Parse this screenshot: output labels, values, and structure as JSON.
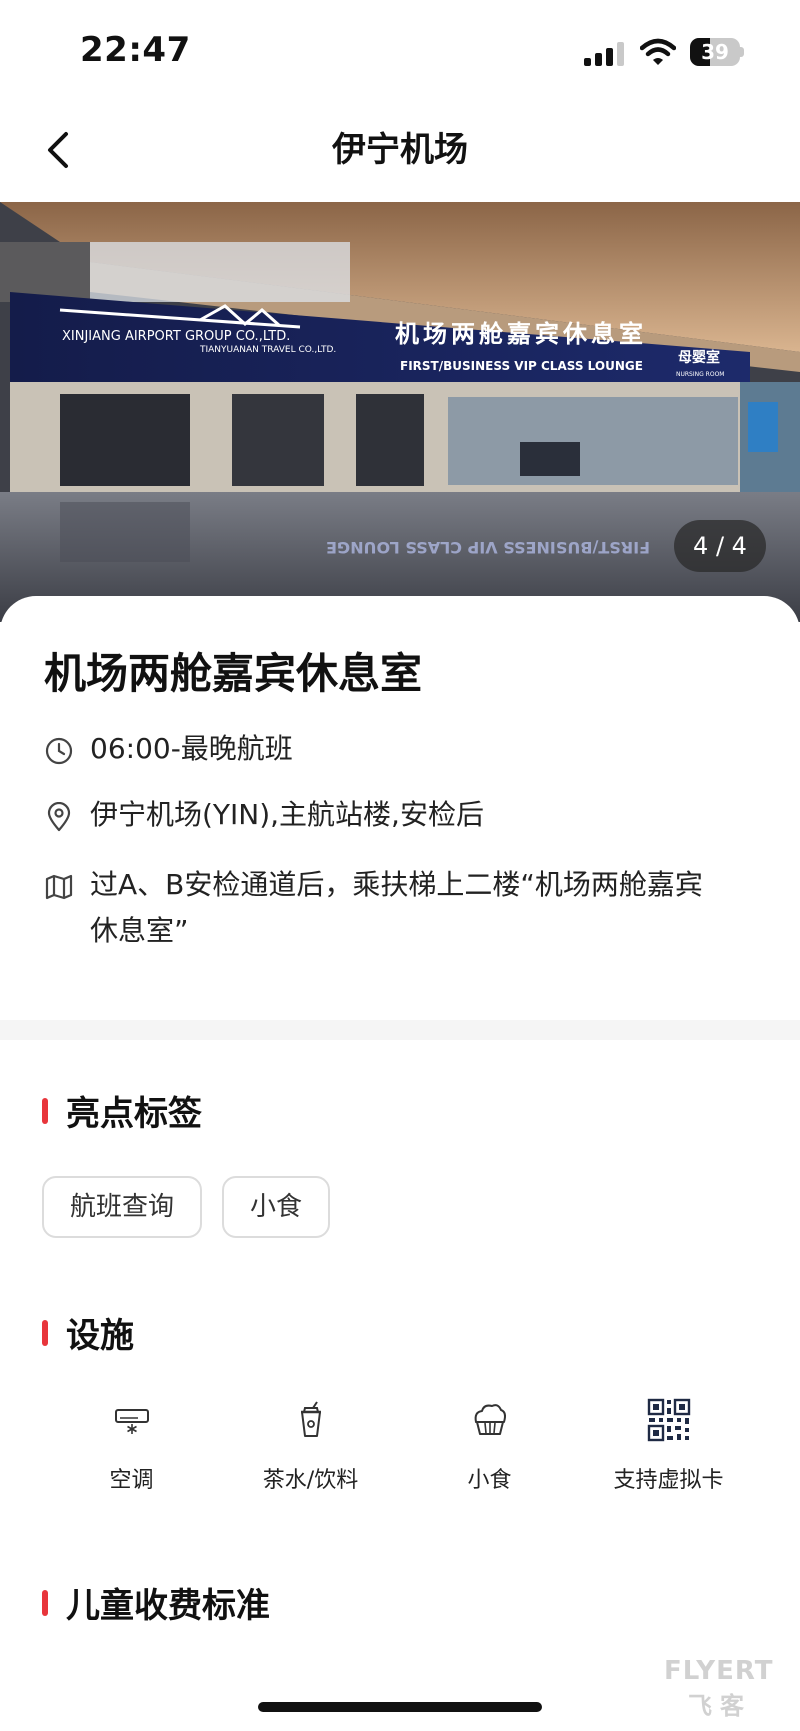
{
  "status_bar": {
    "time": "22:47",
    "battery": "39",
    "battery_level": 0.39
  },
  "nav": {
    "title": "伊宁机场"
  },
  "gallery": {
    "counter": "4 / 4",
    "photo_sign_cn": "机场两舱嘉宾休息室",
    "photo_sign_en": "FIRST/BUSINESS VIP CLASS LOUNGE",
    "photo_sign_company": "XINJIANG AIRPORT GROUP CO.,LTD.",
    "photo_sign_travel": "TIANYUANAN TRAVEL CO.,LTD.",
    "photo_sign_nursing": "母婴室",
    "photo_sign_nursing_en": "NURSING ROOM"
  },
  "lounge": {
    "name": "机场两舱嘉宾休息室",
    "hours": "06:00-最晚航班",
    "location": "伊宁机场(YIN),主航站楼,安检后",
    "directions": "过A、B安检通道后，乘扶梯上二楼“机场两舱嘉宾休息室”"
  },
  "highlights": {
    "title": "亮点标签",
    "tags": [
      "航班查询",
      "小食"
    ]
  },
  "facilities": {
    "title": "设施",
    "items": [
      {
        "label": "空调",
        "icon": "air-conditioner-icon"
      },
      {
        "label": "茶水/饮料",
        "icon": "drink-cup-icon"
      },
      {
        "label": "小食",
        "icon": "snack-icon"
      },
      {
        "label": "支持虚拟卡",
        "icon": "qr-code-icon"
      }
    ]
  },
  "children_fee": {
    "title": "儿童收费标准"
  },
  "watermark": {
    "line1": "FLYERT",
    "line2": "飞客"
  },
  "colors": {
    "accent": "#e8353b",
    "text": "#111111",
    "divider": "#f5f5f5"
  }
}
